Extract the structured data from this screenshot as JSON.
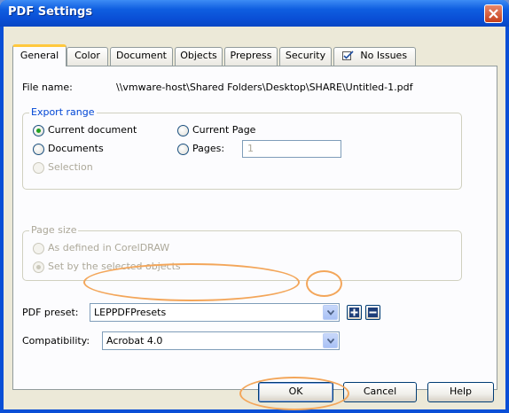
{
  "window": {
    "title": "PDF Settings"
  },
  "tabs": [
    {
      "label": "General"
    },
    {
      "label": "Color"
    },
    {
      "label": "Document"
    },
    {
      "label": "Objects"
    },
    {
      "label": "Prepress"
    },
    {
      "label": "Security"
    },
    {
      "label": "No Issues",
      "icon": "inspect-check-icon"
    }
  ],
  "file": {
    "label": "File name:",
    "value": "\\\\vmware-host\\Shared Folders\\Desktop\\SHARE\\Untitled-1.pdf"
  },
  "export_range": {
    "title": "Export range",
    "current_document": "Current document",
    "documents": "Documents",
    "selection": "Selection",
    "current_page": "Current Page",
    "pages": "Pages:",
    "pages_value": "1",
    "selected": "current_document"
  },
  "page_size": {
    "title": "Page size",
    "as_defined": "As defined in CorelDRAW",
    "set_by_selected": "Set by the selected objects",
    "selected": "set_by_selected"
  },
  "pdf_preset": {
    "label": "PDF preset:",
    "value": "LEPPDFPresets"
  },
  "compatibility": {
    "label": "Compatibility:",
    "value": "Acrobat 4.0"
  },
  "buttons": {
    "ok": "OK",
    "cancel": "Cancel",
    "help": "Help"
  },
  "colors": {
    "title_bar": "#0a4fd6",
    "dialog_bg": "#ece9d8",
    "group_title": "#0046d5",
    "highlight": "#f3a65a"
  }
}
